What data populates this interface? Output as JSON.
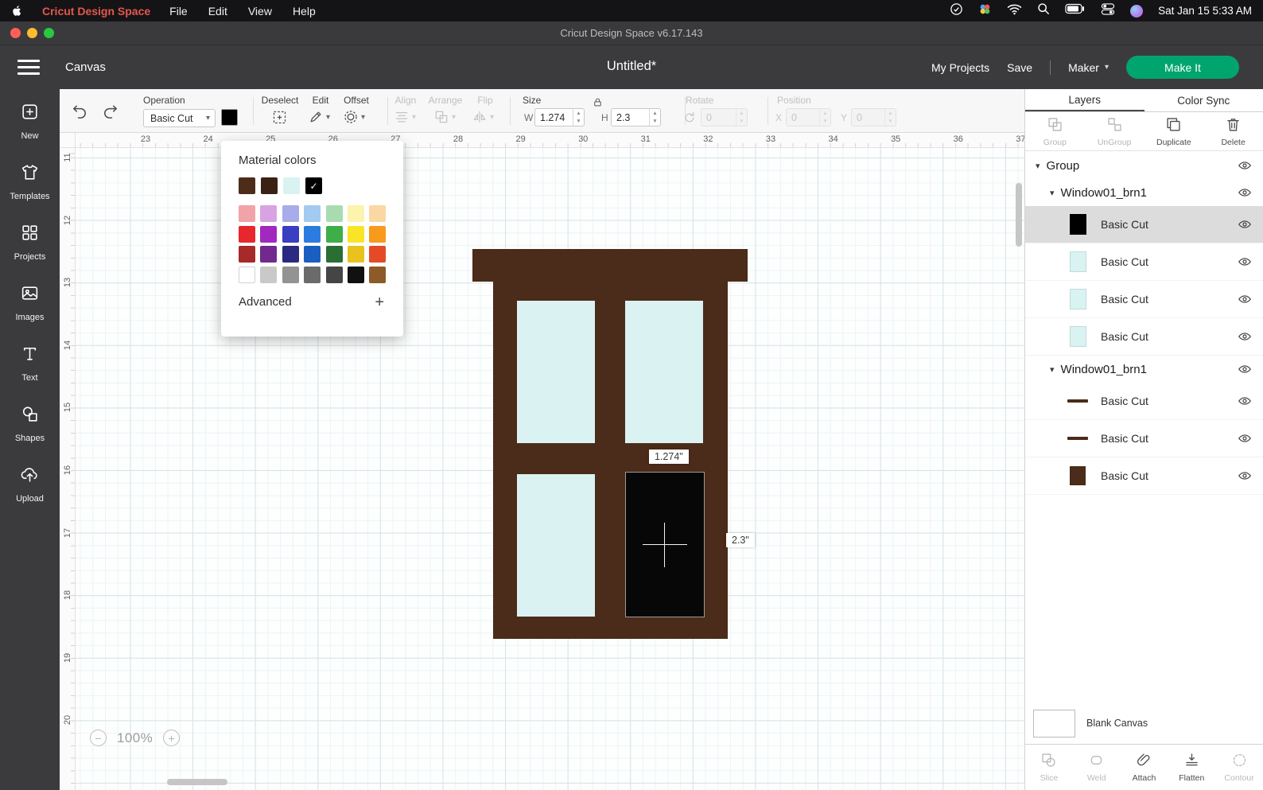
{
  "menubar": {
    "app_name": "Cricut Design Space",
    "menus": [
      "File",
      "Edit",
      "View",
      "Help"
    ],
    "clock": "Sat Jan 15 5:33 AM"
  },
  "titlebar": {
    "title": "Cricut Design Space  v6.17.143"
  },
  "header": {
    "canvas_label": "Canvas",
    "doc_title": "Untitled*",
    "my_projects": "My Projects",
    "save": "Save",
    "machine": "Maker",
    "make_it": "Make It"
  },
  "toolbar": {
    "operation": {
      "label": "Operation",
      "value": "Basic Cut",
      "swatch_color": "#000000"
    },
    "deselect": "Deselect",
    "edit": "Edit",
    "offset": "Offset",
    "align": "Align",
    "arrange": "Arrange",
    "flip": "Flip",
    "size": {
      "label": "Size",
      "w_label": "W",
      "w_value": "1.274",
      "h_label": "H",
      "h_value": "2.3"
    },
    "rotate": {
      "label": "Rotate",
      "value": "0"
    },
    "position": {
      "label": "Position",
      "x_label": "X",
      "x_value": "0",
      "y_label": "Y",
      "y_value": "0"
    }
  },
  "sidebar": {
    "items": [
      {
        "label": "New",
        "icon": "new-icon"
      },
      {
        "label": "Templates",
        "icon": "templates-icon"
      },
      {
        "label": "Projects",
        "icon": "projects-icon"
      },
      {
        "label": "Images",
        "icon": "images-icon"
      },
      {
        "label": "Text",
        "icon": "text-icon"
      },
      {
        "label": "Shapes",
        "icon": "shapes-icon"
      },
      {
        "label": "Upload",
        "icon": "upload-icon"
      }
    ]
  },
  "color_picker": {
    "title": "Material colors",
    "advanced_label": "Advanced",
    "material_swatches": [
      "#4E2C1A",
      "#3A2114",
      "#D9F3F2",
      "#000000"
    ],
    "selected_index": 3,
    "palette": [
      "#F2A3A8",
      "#D9A3E3",
      "#A8ACE8",
      "#A3CBF2",
      "#A8DCB0",
      "#FCF3AC",
      "#FAD8A4",
      "#E8262D",
      "#A229BD",
      "#3A3EC0",
      "#2C7CE0",
      "#3EAE49",
      "#F9E426",
      "#F99A1D",
      "#A62A2A",
      "#71298D",
      "#2A2A81",
      "#1A5FBF",
      "#2A6E33",
      "#E8C21D",
      "#E54A26",
      "#FFFFFF",
      "#C9C9C9",
      "#939393",
      "#6B6B6B",
      "#454545",
      "#111111",
      "#8E5A28"
    ]
  },
  "canvas": {
    "ruler_top": [
      "23",
      "24",
      "25",
      "26",
      "27",
      "28",
      "29",
      "30",
      "31",
      "32",
      "33",
      "34",
      "35",
      "36",
      "37"
    ],
    "ruler_left": [
      "11",
      "12",
      "13",
      "14",
      "15",
      "16",
      "17",
      "18",
      "19",
      "20"
    ],
    "zoom_value": "100%",
    "selection": {
      "width_label": "1.274\"",
      "height_label": "2.3\""
    },
    "artwork_colors": {
      "frame": "#4B2B19",
      "pane": "#DAF3F2",
      "selected_pane": "#070707"
    }
  },
  "layers_panel": {
    "tabs": [
      {
        "label": "Layers",
        "active": true
      },
      {
        "label": "Color Sync",
        "active": false
      }
    ],
    "actions": [
      {
        "label": "Group",
        "icon": "group-icon",
        "enabled": false
      },
      {
        "label": "UnGroup",
        "icon": "ungroup-icon",
        "enabled": false
      },
      {
        "label": "Duplicate",
        "icon": "duplicate-icon",
        "enabled": true
      },
      {
        "label": "Delete",
        "icon": "delete-icon",
        "enabled": true
      }
    ],
    "tree": [
      {
        "kind": "group",
        "label": "Group",
        "indent": 0
      },
      {
        "kind": "group",
        "label": "Window01_brn1",
        "indent": 1
      },
      {
        "kind": "layer",
        "label": "Basic Cut",
        "swatch": "rect",
        "color": "#000000",
        "selected": true
      },
      {
        "kind": "layer",
        "label": "Basic Cut",
        "swatch": "rect",
        "color": "#D9F3F2",
        "selected": false
      },
      {
        "kind": "layer",
        "label": "Basic Cut",
        "swatch": "rect",
        "color": "#D9F3F2",
        "selected": false
      },
      {
        "kind": "layer",
        "label": "Basic Cut",
        "swatch": "rect",
        "color": "#D9F3F2",
        "selected": false
      },
      {
        "kind": "group",
        "label": "Window01_brn1",
        "indent": 1
      },
      {
        "kind": "layer",
        "label": "Basic Cut",
        "swatch": "line",
        "color": "#4B2B19",
        "selected": false
      },
      {
        "kind": "layer",
        "label": "Basic Cut",
        "swatch": "line",
        "color": "#4B2B19",
        "selected": false
      },
      {
        "kind": "layer",
        "label": "Basic Cut",
        "swatch": "square",
        "color": "#4B2B19",
        "selected": false
      }
    ],
    "blank_canvas_label": "Blank Canvas",
    "bottom_actions": [
      {
        "label": "Slice",
        "icon": "slice-icon",
        "enabled": false
      },
      {
        "label": "Weld",
        "icon": "weld-icon",
        "enabled": false
      },
      {
        "label": "Attach",
        "icon": "attach-icon",
        "enabled": true
      },
      {
        "label": "Flatten",
        "icon": "flatten-icon",
        "enabled": true
      },
      {
        "label": "Contour",
        "icon": "contour-icon",
        "enabled": false
      }
    ]
  }
}
